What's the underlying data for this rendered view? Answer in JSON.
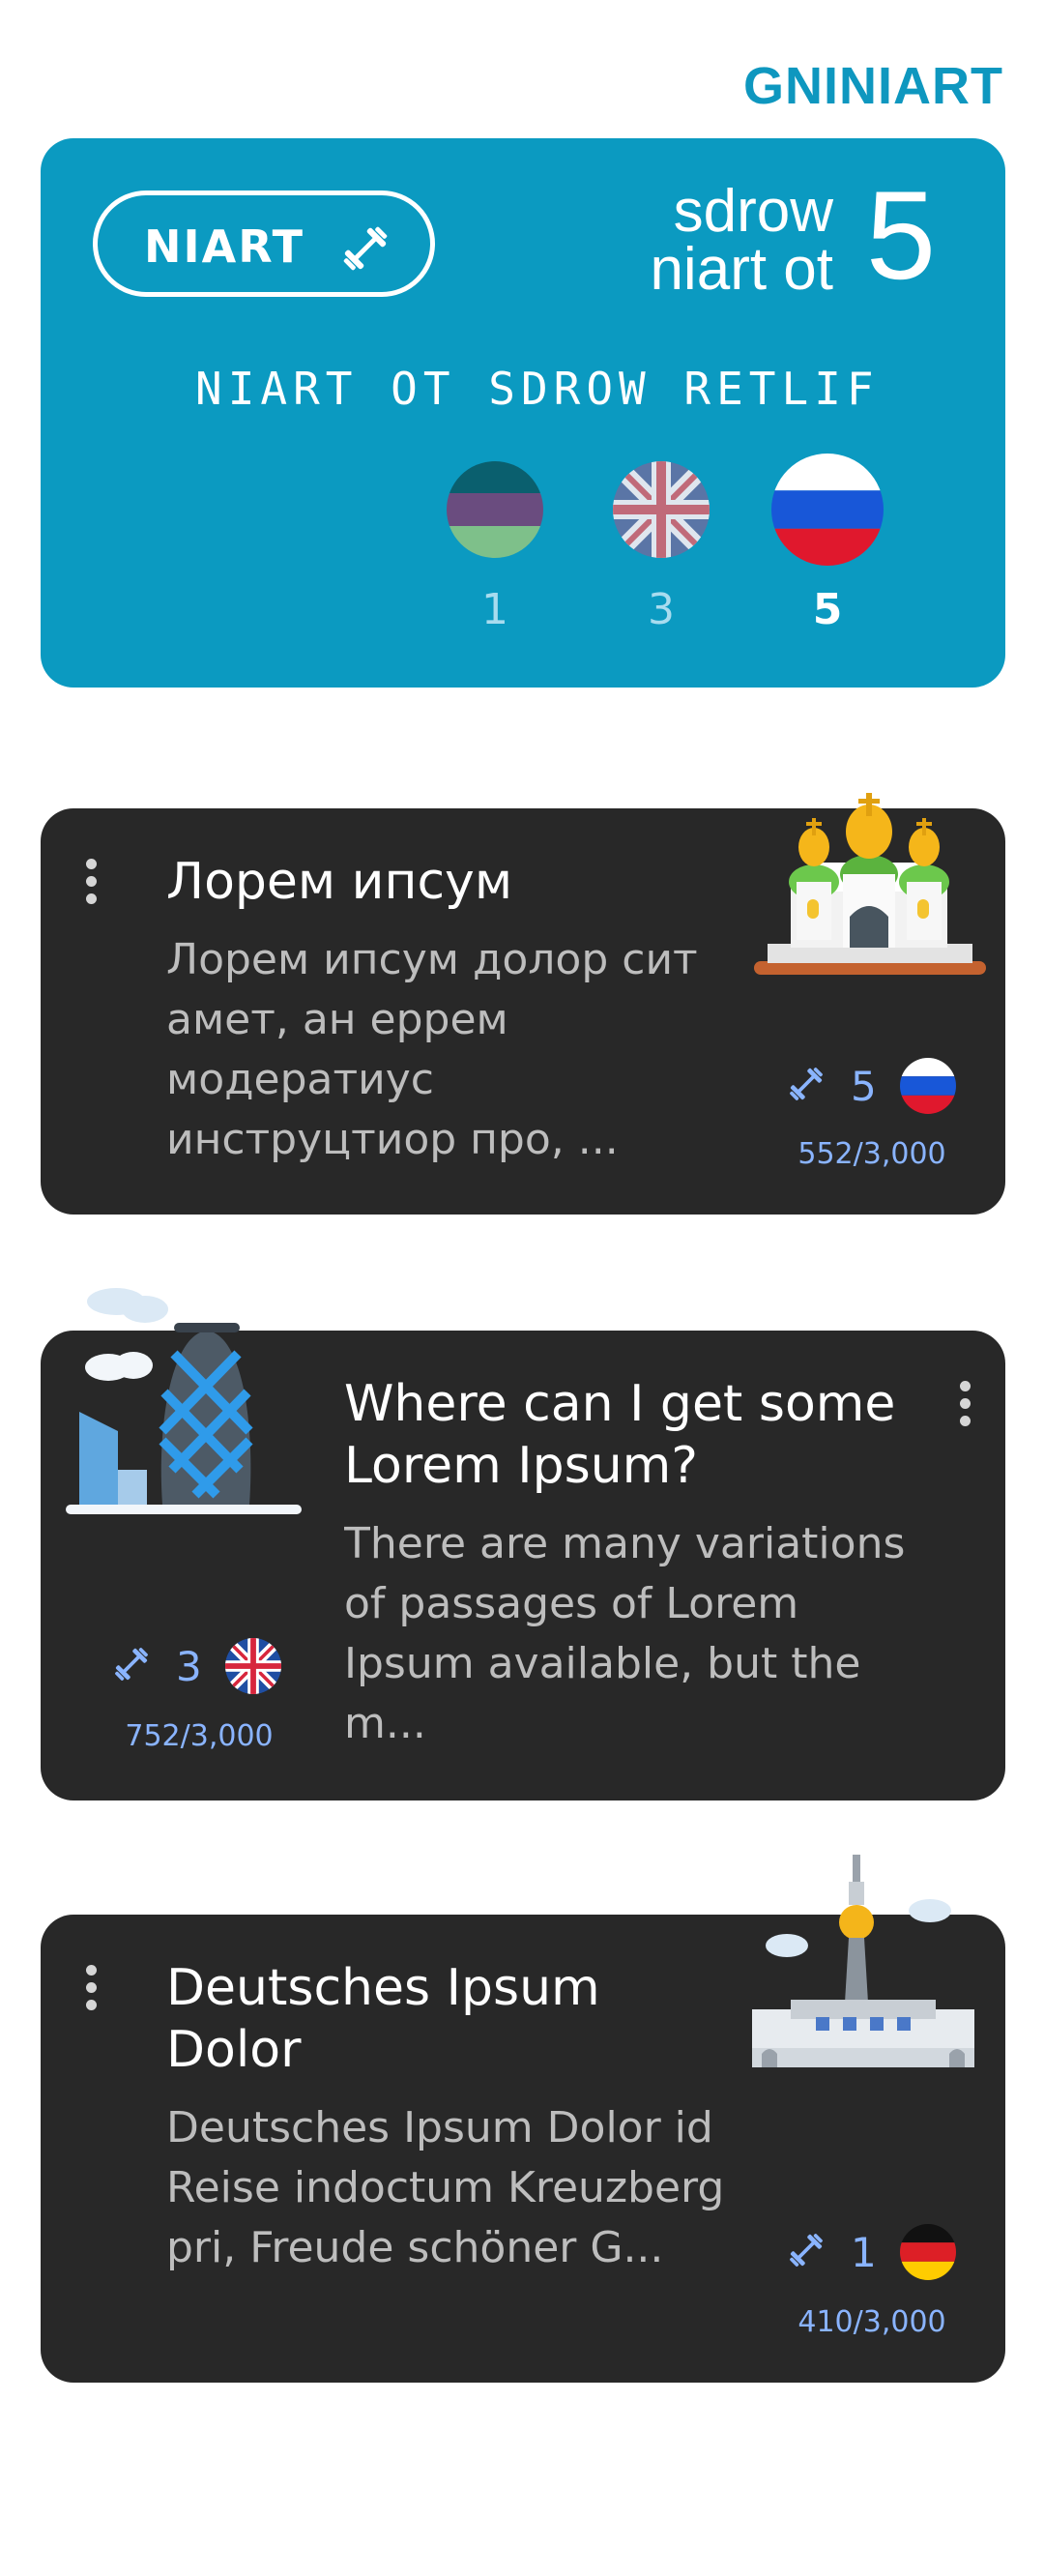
{
  "header": {
    "title": "GNINIART"
  },
  "train_card": {
    "train_button_label": "NIART",
    "words_line1": "sdrow",
    "words_line2": "niart ot",
    "words_count": "5",
    "filter_label": "NIART OT SDROW RETLIF",
    "languages": [
      {
        "flag": "purple-green-flag",
        "count": "1"
      },
      {
        "flag": "uk-flag",
        "count": "3"
      },
      {
        "flag": "russia-flag",
        "count": "5"
      }
    ]
  },
  "texts": [
    {
      "title": "Лорем ипсум",
      "description": "Лорем ипсум долор сит амет, ан еррем модератиус инструцтиор про, ...",
      "words": "5",
      "progress": "552/3,000",
      "flag": "russia-flag",
      "illustration": "church-illustration"
    },
    {
      "title": "Where can I get some Lorem Ipsum?",
      "description": "There are many variations of passages of Lorem Ipsum available, but the m...",
      "words": "3",
      "progress": "752/3,000",
      "flag": "uk-flag",
      "illustration": "gherkin-tower-illustration"
    },
    {
      "title": "Deutsches Ipsum Dolor",
      "description": "Deutsches Ipsum Dolor id Reise indoctum Kreuzberg pri, Freude schöner G...",
      "words": "1",
      "progress": "410/3,000",
      "flag": "germany-flag",
      "illustration": "tv-tower-illustration"
    }
  ],
  "colors": {
    "accent": "#0B9AC1",
    "card_bg": "#282828",
    "stat_blue": "#8ab4ff"
  }
}
